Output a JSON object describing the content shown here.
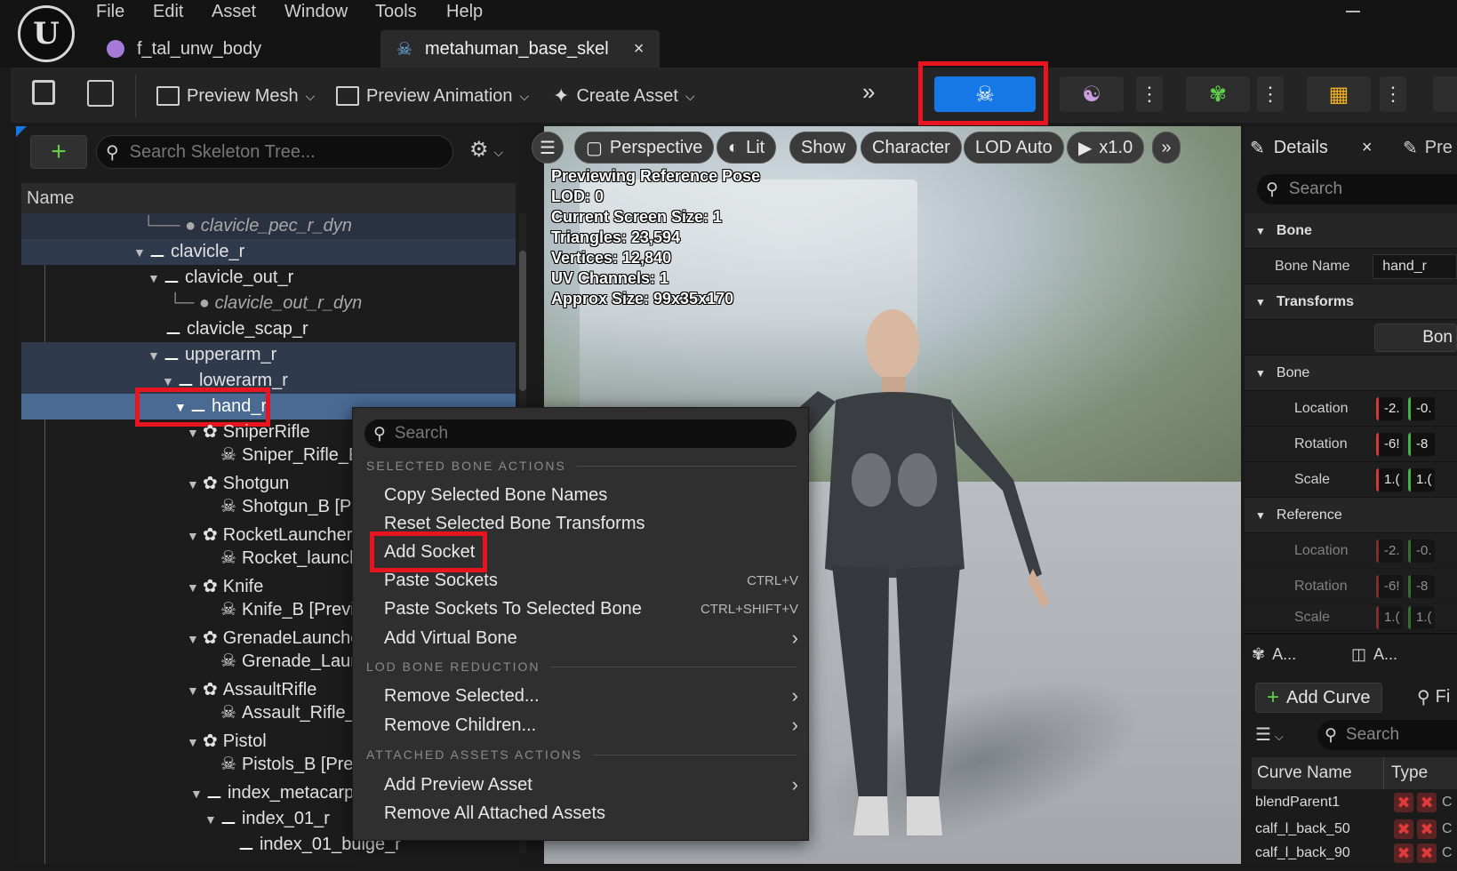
{
  "menu": [
    "File",
    "Edit",
    "Asset",
    "Window",
    "Tools",
    "Help"
  ],
  "tabs": [
    {
      "label": "f_tal_unw_body"
    },
    {
      "label": "metahuman_base_skel",
      "close": "×"
    }
  ],
  "toolbar": {
    "preview_mesh": "Preview Mesh",
    "preview_animation": "Preview Animation",
    "create_asset": "Create Asset"
  },
  "skeleton_tree": {
    "search_placeholder": "Search Skeleton Tree...",
    "column_name": "Name",
    "rows": [
      {
        "label": "clavicle_pec_r_dyn"
      },
      {
        "label": "clavicle_r"
      },
      {
        "label": "clavicle_out_r"
      },
      {
        "label": "clavicle_out_r_dyn"
      },
      {
        "label": "clavicle_scap_r"
      },
      {
        "label": "upperarm_r"
      },
      {
        "label": "lowerarm_r"
      },
      {
        "label": "hand_r"
      },
      {
        "label": "SniperRifle"
      },
      {
        "label": "Sniper_Rifle_B [I"
      },
      {
        "label": "Shotgun"
      },
      {
        "label": "Shotgun_B [Prev"
      },
      {
        "label": "RocketLauncher"
      },
      {
        "label": "Rocket_launcher"
      },
      {
        "label": "Knife"
      },
      {
        "label": "Knife_B [Previev"
      },
      {
        "label": "GrenadeLauncher"
      },
      {
        "label": "Grenade_Launch"
      },
      {
        "label": "AssaultRifle"
      },
      {
        "label": "Assault_Rifle_B"
      },
      {
        "label": "Pistol"
      },
      {
        "label": "Pistols_B [Previe"
      },
      {
        "label": "index_metacarpa"
      },
      {
        "label": "index_01_r"
      },
      {
        "label": "index_01_bulge_r"
      }
    ]
  },
  "viewport": {
    "buttons": [
      "Perspective",
      "Lit",
      "Show",
      "Character",
      "LOD Auto",
      "x1.0"
    ],
    "stats": [
      "Previewing Reference Pose",
      "LOD: 0",
      "Current Screen Size: 1",
      "Triangles: 23,594",
      "Vertices: 12,840",
      "UV Channels: 1",
      "Approx Size: 99x35x170"
    ]
  },
  "context_menu": {
    "search_placeholder": "Search",
    "sections": [
      {
        "header": "SELECTED BONE ACTIONS"
      },
      {
        "header": "LOD BONE REDUCTION"
      },
      {
        "header": "ATTACHED ASSETS ACTIONS"
      }
    ],
    "items": [
      {
        "label": "Copy Selected Bone Names",
        "shortcut": ""
      },
      {
        "label": "Reset Selected Bone Transforms",
        "shortcut": ""
      },
      {
        "label": "Add Socket",
        "shortcut": ""
      },
      {
        "label": "Paste Sockets",
        "shortcut": "CTRL+V"
      },
      {
        "label": "Paste Sockets To Selected Bone",
        "shortcut": "CTRL+SHIFT+V"
      },
      {
        "label": "Add Virtual Bone",
        "shortcut": ""
      },
      {
        "label": "Remove Selected...",
        "shortcut": ""
      },
      {
        "label": "Remove Children...",
        "shortcut": ""
      },
      {
        "label": "Add Preview Asset",
        "shortcut": ""
      },
      {
        "label": "Remove All Attached Assets",
        "shortcut": ""
      }
    ]
  },
  "details": {
    "tab": "Details",
    "tab_close": "×",
    "tab2": "Pre",
    "search_placeholder": "Search",
    "bone_section": "Bone",
    "bone_name_label": "Bone Name",
    "bone_name_value": "hand_r",
    "transforms_section": "Transforms",
    "bone_button": "Bon",
    "bone_sub": "Bone",
    "location": "Location",
    "rotation": "Rotation",
    "scale": "Scale",
    "reference_section": "Reference",
    "loc_vals": [
      "-2.",
      "-0."
    ],
    "rot_vals": [
      "-6!",
      "-8"
    ],
    "scale_vals": [
      "1.(",
      "1.("
    ]
  },
  "curves": {
    "tab_a1": "A...",
    "tab_a2": "A...",
    "add_curve": "Add Curve",
    "find": "Fi",
    "search_placeholder": "Search",
    "col_name": "Curve Name",
    "col_type": "Type",
    "rows": [
      {
        "name": "blendParent1",
        "extra": "C"
      },
      {
        "name": "calf_l_back_50",
        "extra": "C"
      },
      {
        "name": "calf_l_back_90",
        "extra": "C"
      }
    ]
  },
  "colors": {
    "accent_blue": "#1677e6",
    "highlight_red": "#e8141f",
    "selection": "#4a6a94"
  }
}
